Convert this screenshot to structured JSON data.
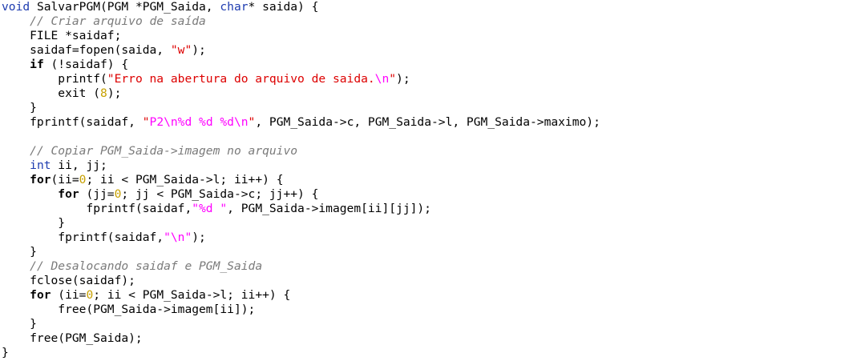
{
  "colors": {
    "background": "#ffffff",
    "text": "#000000",
    "type_keyword": "#1e3cb0",
    "comment": "#7a7a7a",
    "string": "#dd0000",
    "escape_format": "#ff00ff",
    "number": "#c7a000"
  },
  "code": {
    "lines": [
      [
        [
          "type",
          "void"
        ],
        [
          "plain",
          " SalvarPGM(PGM *PGM_Saida, "
        ],
        [
          "type",
          "char"
        ],
        [
          "plain",
          "* saida) {"
        ]
      ],
      [
        [
          "plain",
          "    "
        ],
        [
          "cm",
          "// Criar arquivo de saída"
        ]
      ],
      [
        [
          "plain",
          "    FILE *saidaf;"
        ]
      ],
      [
        [
          "plain",
          "    saidaf=fopen(saida, "
        ],
        [
          "str",
          "\"w\""
        ],
        [
          "plain",
          ");"
        ]
      ],
      [
        [
          "plain",
          "    "
        ],
        [
          "kw",
          "if"
        ],
        [
          "plain",
          " (!saidaf) {"
        ]
      ],
      [
        [
          "plain",
          "        printf("
        ],
        [
          "str",
          "\"Erro na abertura do arquivo de saida."
        ],
        [
          "esc",
          "\\n"
        ],
        [
          "str",
          "\""
        ],
        [
          "plain",
          ");"
        ]
      ],
      [
        [
          "plain",
          "        exit ("
        ],
        [
          "num",
          "8"
        ],
        [
          "plain",
          ");"
        ]
      ],
      [
        [
          "plain",
          "    }"
        ]
      ],
      [
        [
          "plain",
          "    fprintf(saidaf, "
        ],
        [
          "str",
          "\""
        ],
        [
          "esc",
          "P2\\n%d %d %d\\n"
        ],
        [
          "str",
          "\""
        ],
        [
          "plain",
          ", PGM_Saida->c, PGM_Saida->l, PGM_Saida->maximo);"
        ]
      ],
      [
        [
          "plain",
          ""
        ]
      ],
      [
        [
          "plain",
          "    "
        ],
        [
          "cm",
          "// Copiar PGM_Saida->imagem no arquivo"
        ]
      ],
      [
        [
          "plain",
          "    "
        ],
        [
          "type",
          "int"
        ],
        [
          "plain",
          " ii, jj;"
        ]
      ],
      [
        [
          "plain",
          "    "
        ],
        [
          "kw",
          "for"
        ],
        [
          "plain",
          "(ii="
        ],
        [
          "num",
          "0"
        ],
        [
          "plain",
          "; ii < PGM_Saida->l; ii++) {"
        ]
      ],
      [
        [
          "plain",
          "        "
        ],
        [
          "kw",
          "for"
        ],
        [
          "plain",
          " (jj="
        ],
        [
          "num",
          "0"
        ],
        [
          "plain",
          "; jj < PGM_Saida->c; jj++) {"
        ]
      ],
      [
        [
          "plain",
          "            fprintf(saidaf,"
        ],
        [
          "esc",
          "\"%d \""
        ],
        [
          "plain",
          ", PGM_Saida->imagem[ii][jj]);"
        ]
      ],
      [
        [
          "plain",
          "        }"
        ]
      ],
      [
        [
          "plain",
          "        fprintf(saidaf,"
        ],
        [
          "esc",
          "\"\\n\""
        ],
        [
          "plain",
          ");"
        ]
      ],
      [
        [
          "plain",
          "    }"
        ]
      ],
      [
        [
          "plain",
          "    "
        ],
        [
          "cm",
          "// Desalocando saidaf e PGM_Saida"
        ]
      ],
      [
        [
          "plain",
          "    fclose(saidaf);"
        ]
      ],
      [
        [
          "plain",
          "    "
        ],
        [
          "kw",
          "for"
        ],
        [
          "plain",
          " (ii="
        ],
        [
          "num",
          "0"
        ],
        [
          "plain",
          "; ii < PGM_Saida->l; ii++) {"
        ]
      ],
      [
        [
          "plain",
          "        free(PGM_Saida->imagem[ii]);"
        ]
      ],
      [
        [
          "plain",
          "    }"
        ]
      ],
      [
        [
          "plain",
          "    free(PGM_Saida);"
        ]
      ],
      [
        [
          "plain",
          "}"
        ]
      ]
    ]
  }
}
